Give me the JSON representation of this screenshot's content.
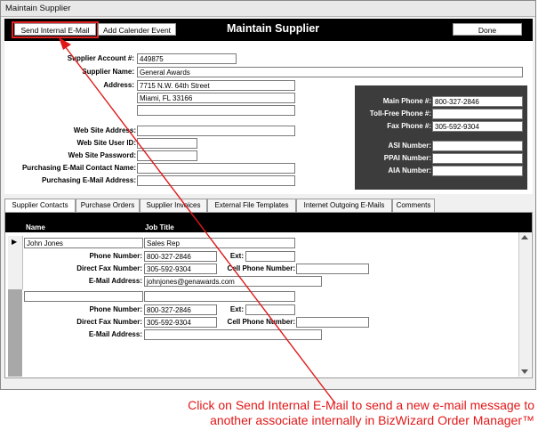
{
  "window": {
    "title": "Maintain Supplier"
  },
  "header": {
    "send_email_label": "Send Internal E-Mail",
    "calendar_label": "Add Calender Event",
    "title": "Maintain Supplier",
    "done_label": "Done"
  },
  "supplier": {
    "account_label": "Supplier Account #:",
    "account_value": "449875",
    "name_label": "Supplier Name:",
    "name_value": "General Awards",
    "address_label": "Address:",
    "address_line1": "7715 N.W. 64th Street",
    "address_line2": "Miami, FL  33166",
    "address_line3": "",
    "website_label": "Web Site Address:",
    "website_value": "",
    "website_user_label": "Web Site User ID:",
    "website_user_value": "",
    "website_pass_label": "Web Site Password:",
    "website_pass_value": "",
    "purch_contact_label": "Purchasing E-Mail Contact Name:",
    "purch_contact_value": "",
    "purch_email_label": "Purchasing E-Mail Address:",
    "purch_email_value": ""
  },
  "phones": {
    "main_label": "Main Phone #:",
    "main_value": "800-327-2846",
    "tollfree_label": "Toll-Free Phone #:",
    "tollfree_value": "",
    "fax_label": "Fax Phone #:",
    "fax_value": "305-592-9304",
    "asi_label": "ASI Number:",
    "asi_value": "",
    "ppai_label": "PPAI Number:",
    "ppai_value": "",
    "aia_label": "AIA Number:",
    "aia_value": ""
  },
  "tabs": [
    "Supplier Contacts",
    "Purchase Orders",
    "Supplier Invoices",
    "External File Templates",
    "Internet Outgoing E-Mails",
    "Comments"
  ],
  "contacts": {
    "col_name": "Name",
    "col_job": "Job Title",
    "phone_label": "Phone Number:",
    "fax_label": "Direct Fax Number:",
    "email_label": "E-Mail Address:",
    "ext_label": "Ext:",
    "cell_label": "Cell Phone Number:",
    "rows": [
      {
        "name": "John Jones",
        "job": "Sales Rep",
        "phone": "800-327-2846",
        "fax": "305-592-9304",
        "email": "johnjones@genawards.com",
        "ext": "",
        "cell": ""
      },
      {
        "name": "",
        "job": "",
        "phone": "800-327-2846",
        "fax": "305-592-9304",
        "email": "",
        "ext": "",
        "cell": ""
      }
    ]
  },
  "caption": {
    "line1": "Click on Send Internal E-Mail to send a new e-mail message to",
    "line2": "another associate internally in BizWizard Order Manager™"
  },
  "colors": {
    "highlight": "#e02020",
    "caption": "#e01818",
    "header_bg": "#000000",
    "phone_panel_bg": "#3c3c3c"
  }
}
